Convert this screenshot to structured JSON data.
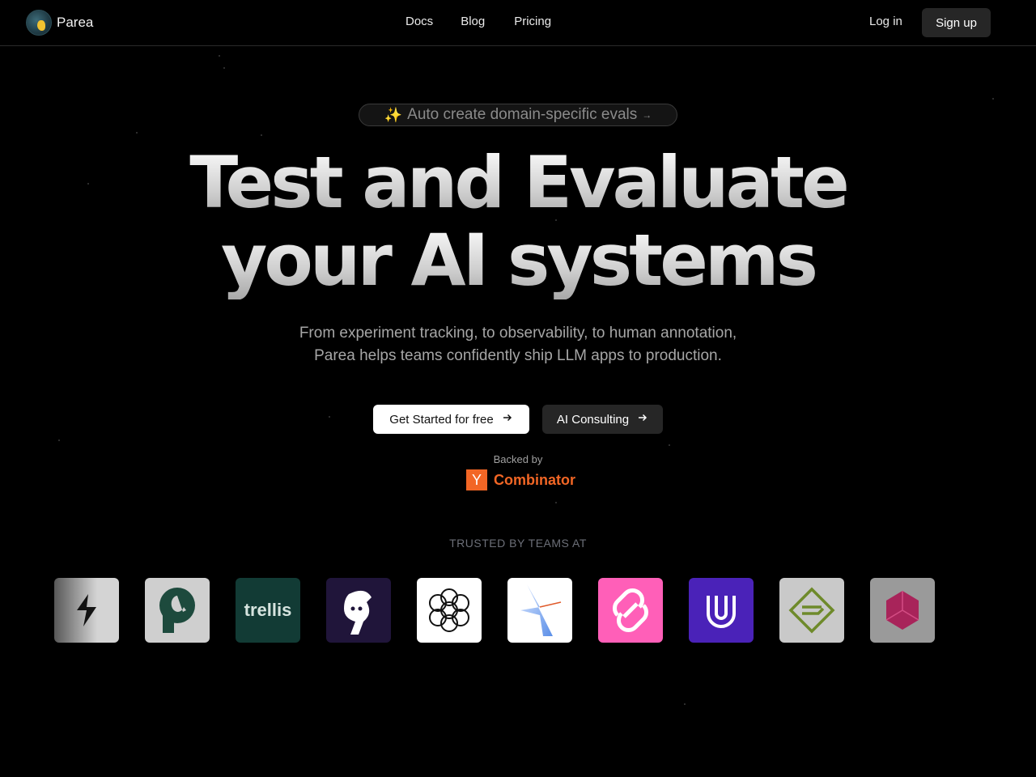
{
  "nav": {
    "brand": "Parea",
    "links": [
      "Docs",
      "Blog",
      "Pricing"
    ],
    "login": "Log in",
    "signup": "Sign up"
  },
  "hero": {
    "pill_text": "Auto create domain-specific evals",
    "headline_line1": "Test and Evaluate",
    "headline_line2": "your AI systems",
    "sub_line1": "From experiment tracking, to observability, to human annotation,",
    "sub_line2": "Parea helps teams confidently ship LLM apps to production.",
    "cta_primary": "Get Started for free",
    "cta_secondary": "AI Consulting",
    "backed_by": "Backed by",
    "yc_letter": "Y",
    "yc_word": "Combinator"
  },
  "trusted": {
    "heading": "TRUSTED BY TEAMS AT",
    "trellis_text": "trellis"
  },
  "colors": {
    "background": "#000000",
    "yc_orange": "#f26625",
    "pill_spark": "#f0c02a"
  }
}
